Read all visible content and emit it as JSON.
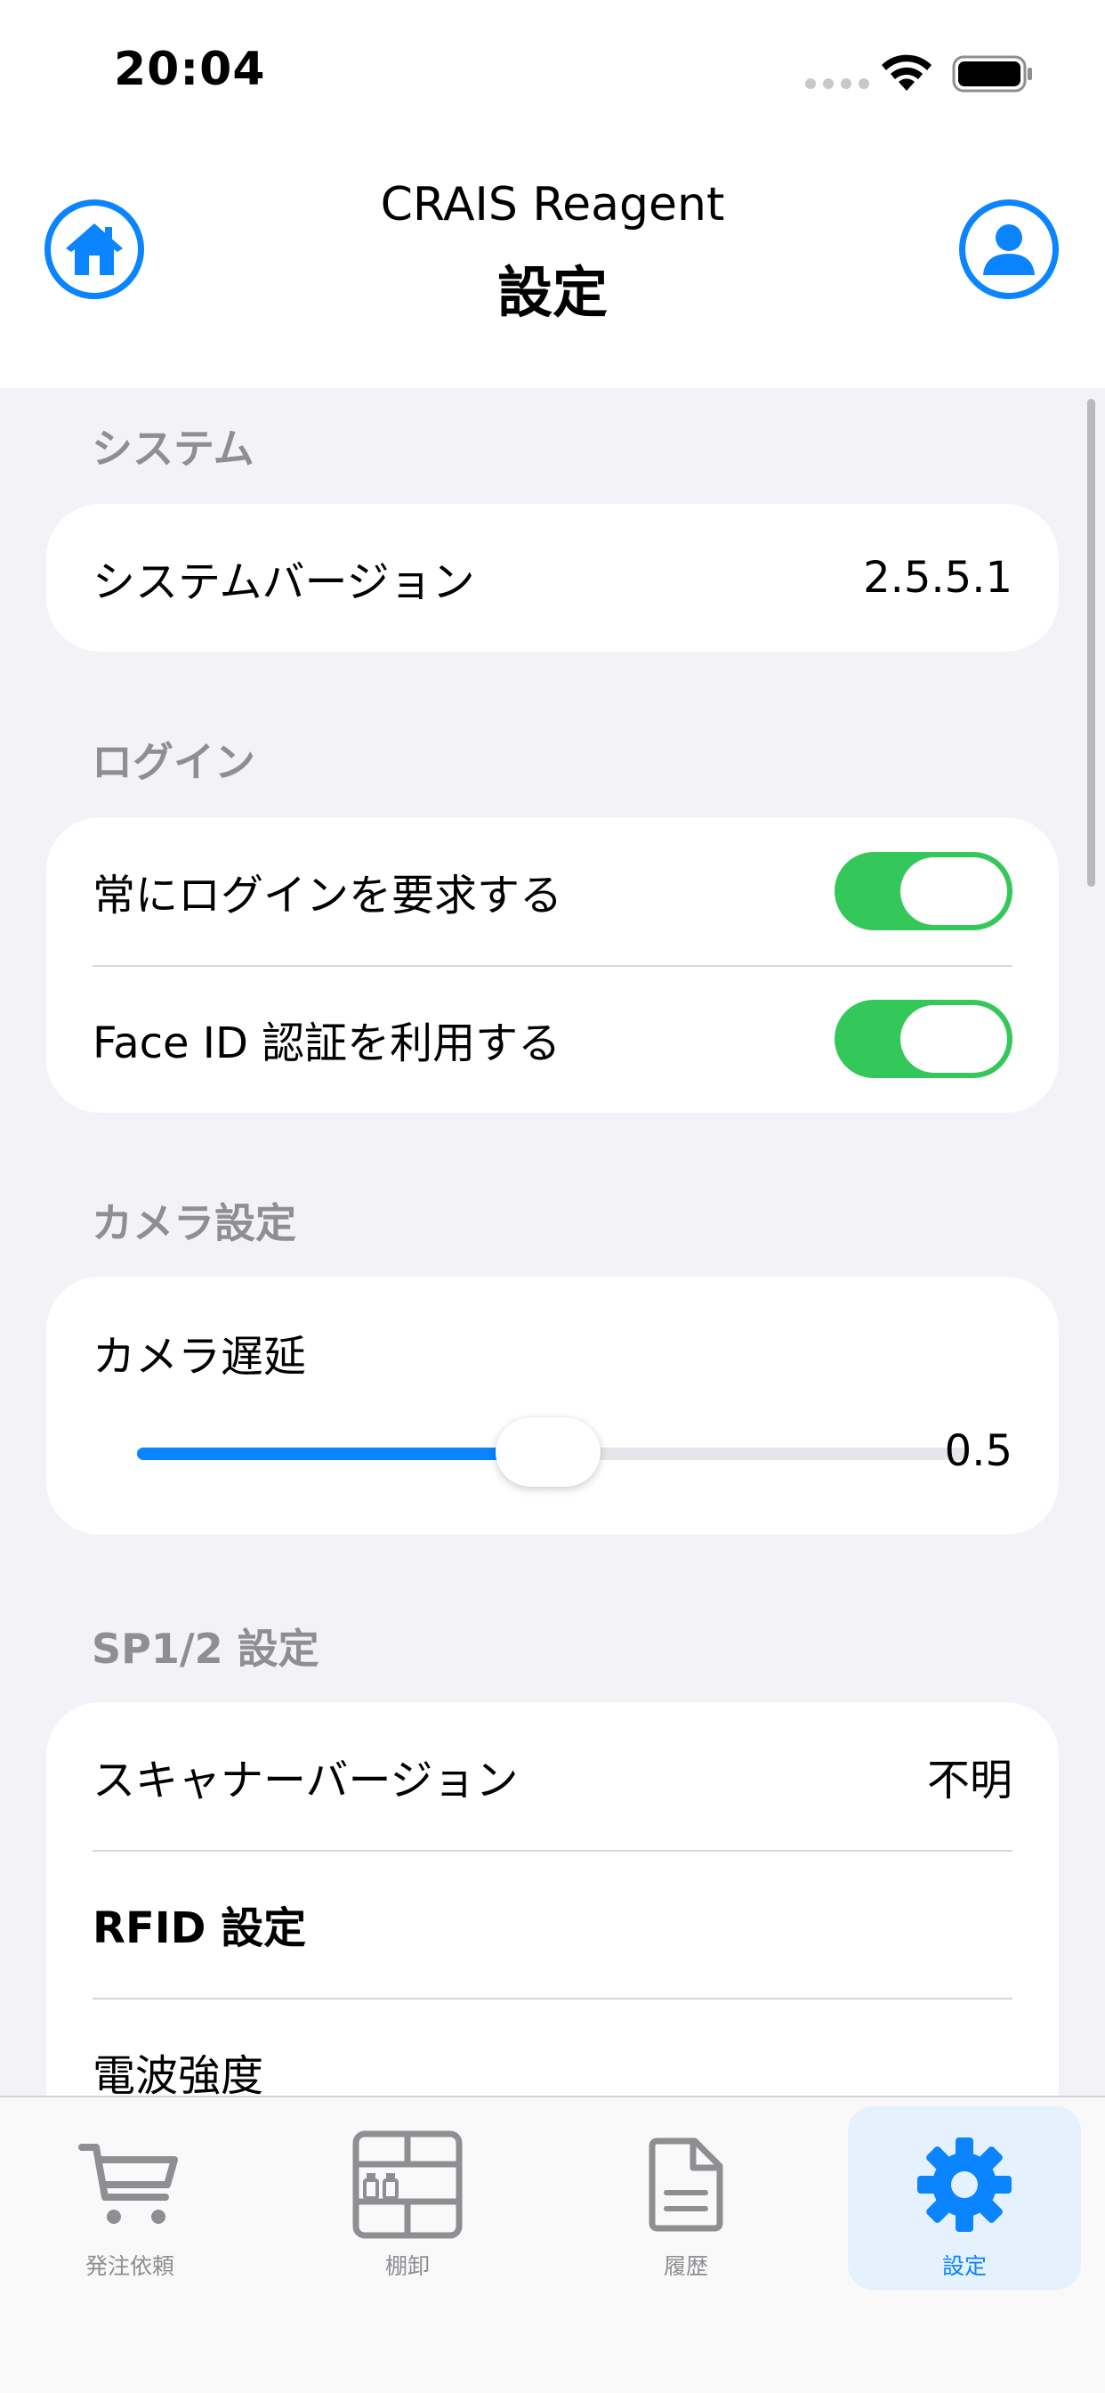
{
  "status_bar": {
    "time": "20:04"
  },
  "header": {
    "app_title": "CRAIS Reagent",
    "page_title": "設定",
    "left_icon": "home-icon",
    "right_icon": "person-icon"
  },
  "sections": {
    "system": {
      "header": "システム",
      "version_label": "システムバージョン",
      "version_value": "2.5.5.1"
    },
    "login": {
      "header": "ログイン",
      "always_login_label": "常にログインを要求する",
      "always_login_on": true,
      "faceid_label": "Face ID 認証を利用する",
      "faceid_on": true
    },
    "camera": {
      "header": "カメラ設定",
      "delay_label": "カメラ遅延",
      "delay_value": "0.5",
      "delay_fraction": 0.5
    },
    "sp": {
      "header": "SP1/2 設定",
      "scanner_label": "スキャナーバージョン",
      "scanner_value": "不明",
      "rfid_label": "RFID 設定",
      "radio_label": "電波強度"
    }
  },
  "tabs": [
    {
      "label": "発注依頼",
      "icon": "cart-icon",
      "active": false
    },
    {
      "label": "棚卸",
      "icon": "shelf-icon",
      "active": false
    },
    {
      "label": "履歴",
      "icon": "document-icon",
      "active": false
    },
    {
      "label": "設定",
      "icon": "gear-icon",
      "active": true
    }
  ],
  "colors": {
    "accent": "#0a84ff",
    "toggle_on": "#34c759",
    "background": "#f2f2f7"
  }
}
